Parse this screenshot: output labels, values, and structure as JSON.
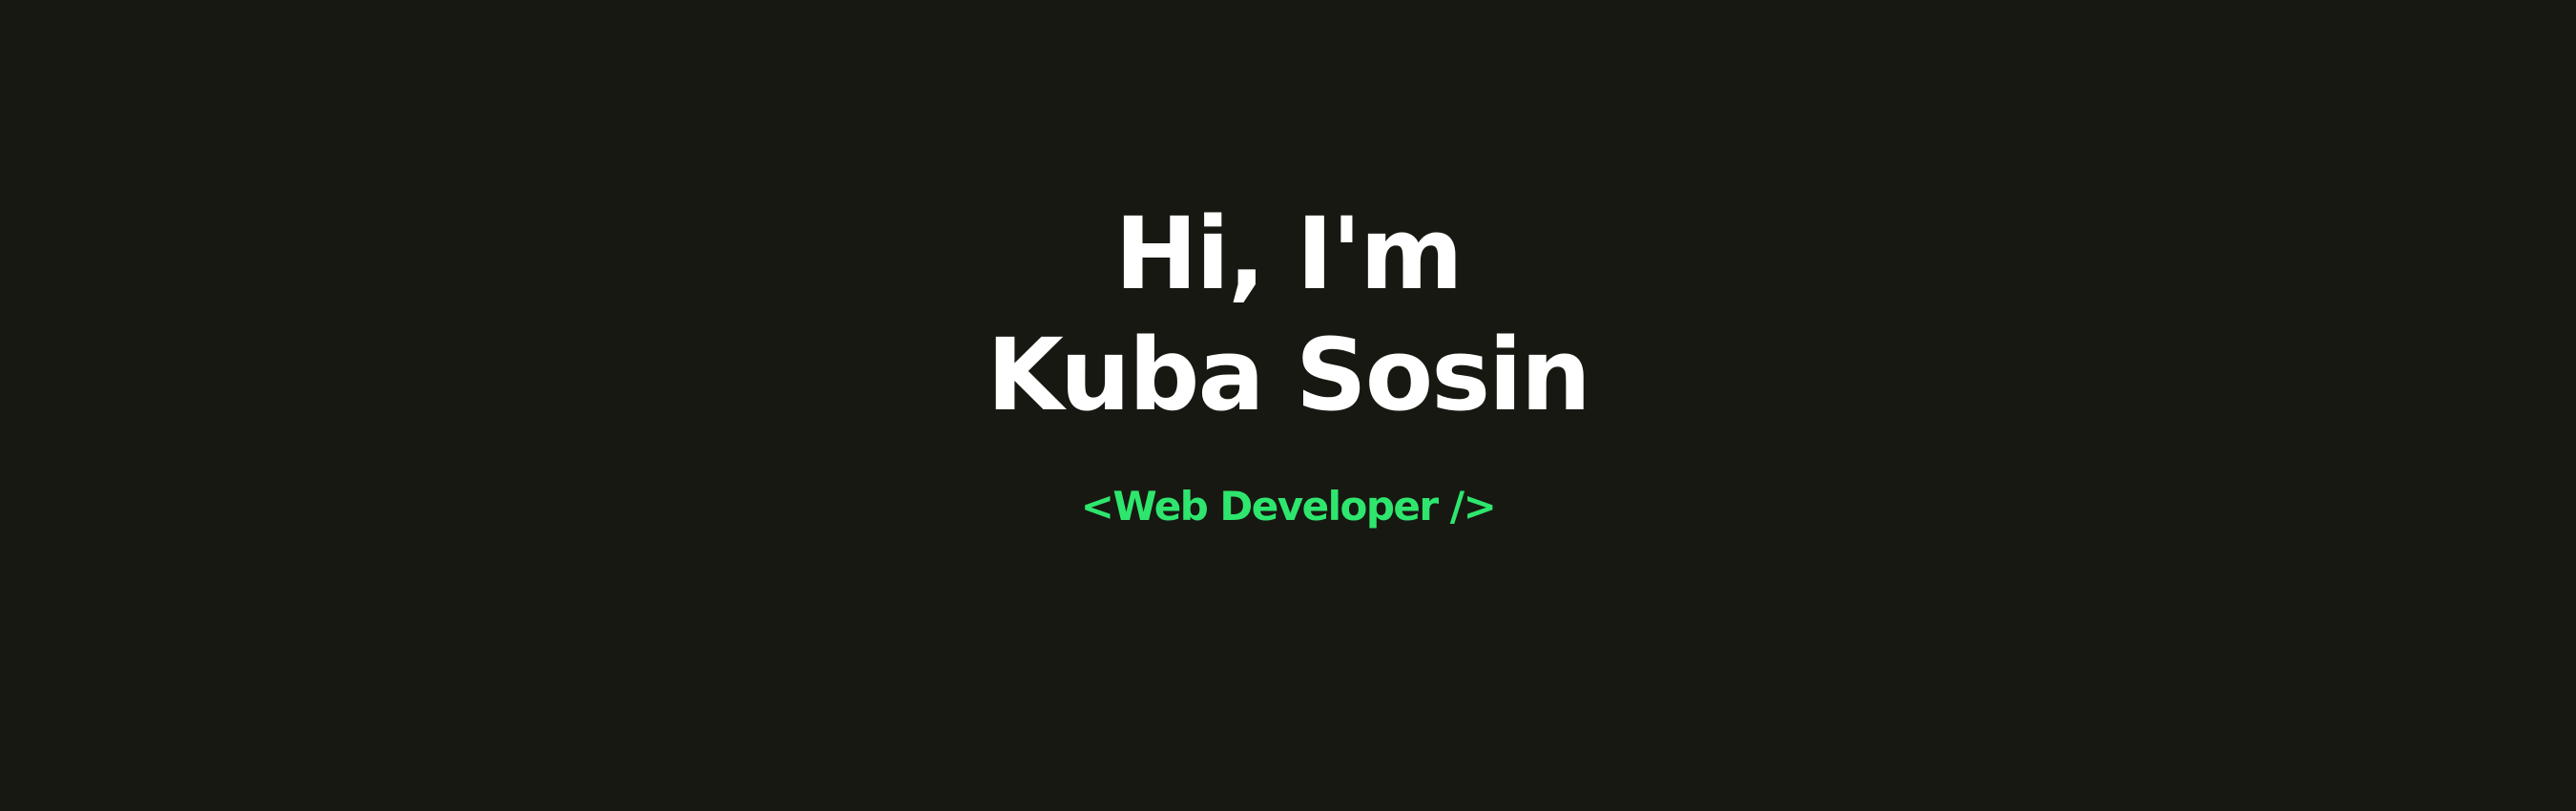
{
  "hero": {
    "greeting": "Hi, I'm",
    "name": "Kuba Sosin",
    "role": "<Web Developer />"
  },
  "colors": {
    "background": "#181812",
    "heading": "#ffffff",
    "accent": "#2ee66e"
  }
}
